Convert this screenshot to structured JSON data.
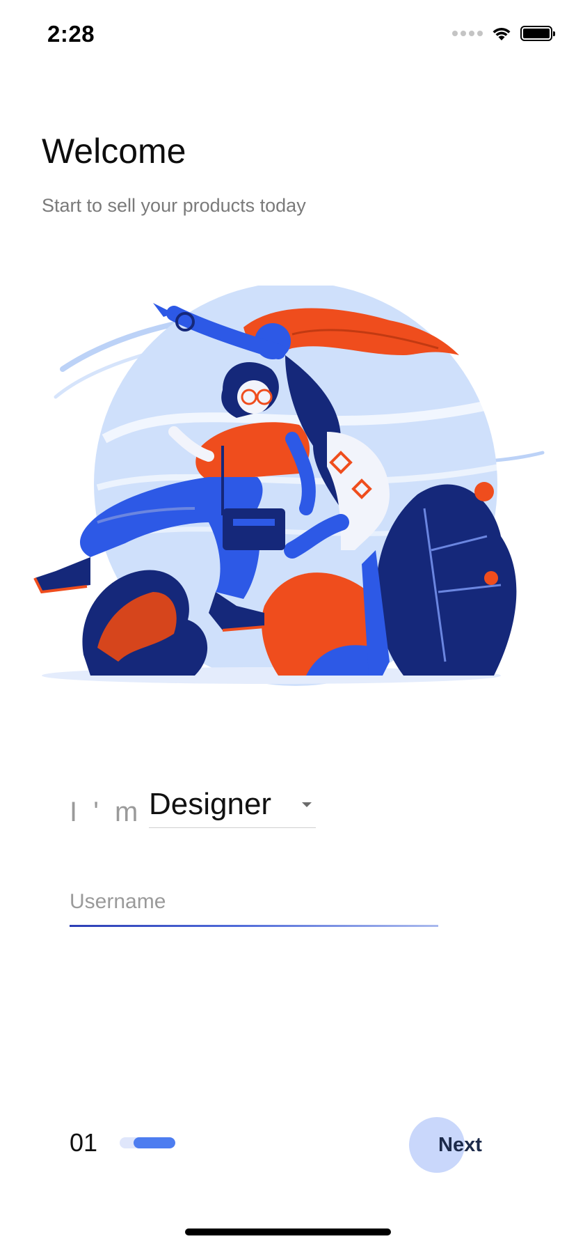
{
  "status_bar": {
    "time": "2:28",
    "icons": [
      "signal-dots-icon",
      "wifi-icon",
      "battery-icon"
    ]
  },
  "header": {
    "title": "Welcome",
    "subtitle": "Start to sell your products today"
  },
  "illustration": {
    "description_icon": "two-dancing-people-illustration",
    "colors": {
      "blue": "#2d59e6",
      "navy": "#15287a",
      "orange": "#ef4d1d",
      "light_blue": "#cfe0fb"
    }
  },
  "form": {
    "role_prefix": "I ' m",
    "role_selected": "Designer",
    "username_placeholder": "Username",
    "username_value": ""
  },
  "footer": {
    "page_number": "01",
    "progress_fraction": 0.75,
    "next_label": "Next"
  },
  "colors": {
    "accent": "#4d7df0",
    "accent_light": "#c9d7fb",
    "underline_start": "#2c3eb5",
    "underline_end": "#a9b9ee"
  }
}
